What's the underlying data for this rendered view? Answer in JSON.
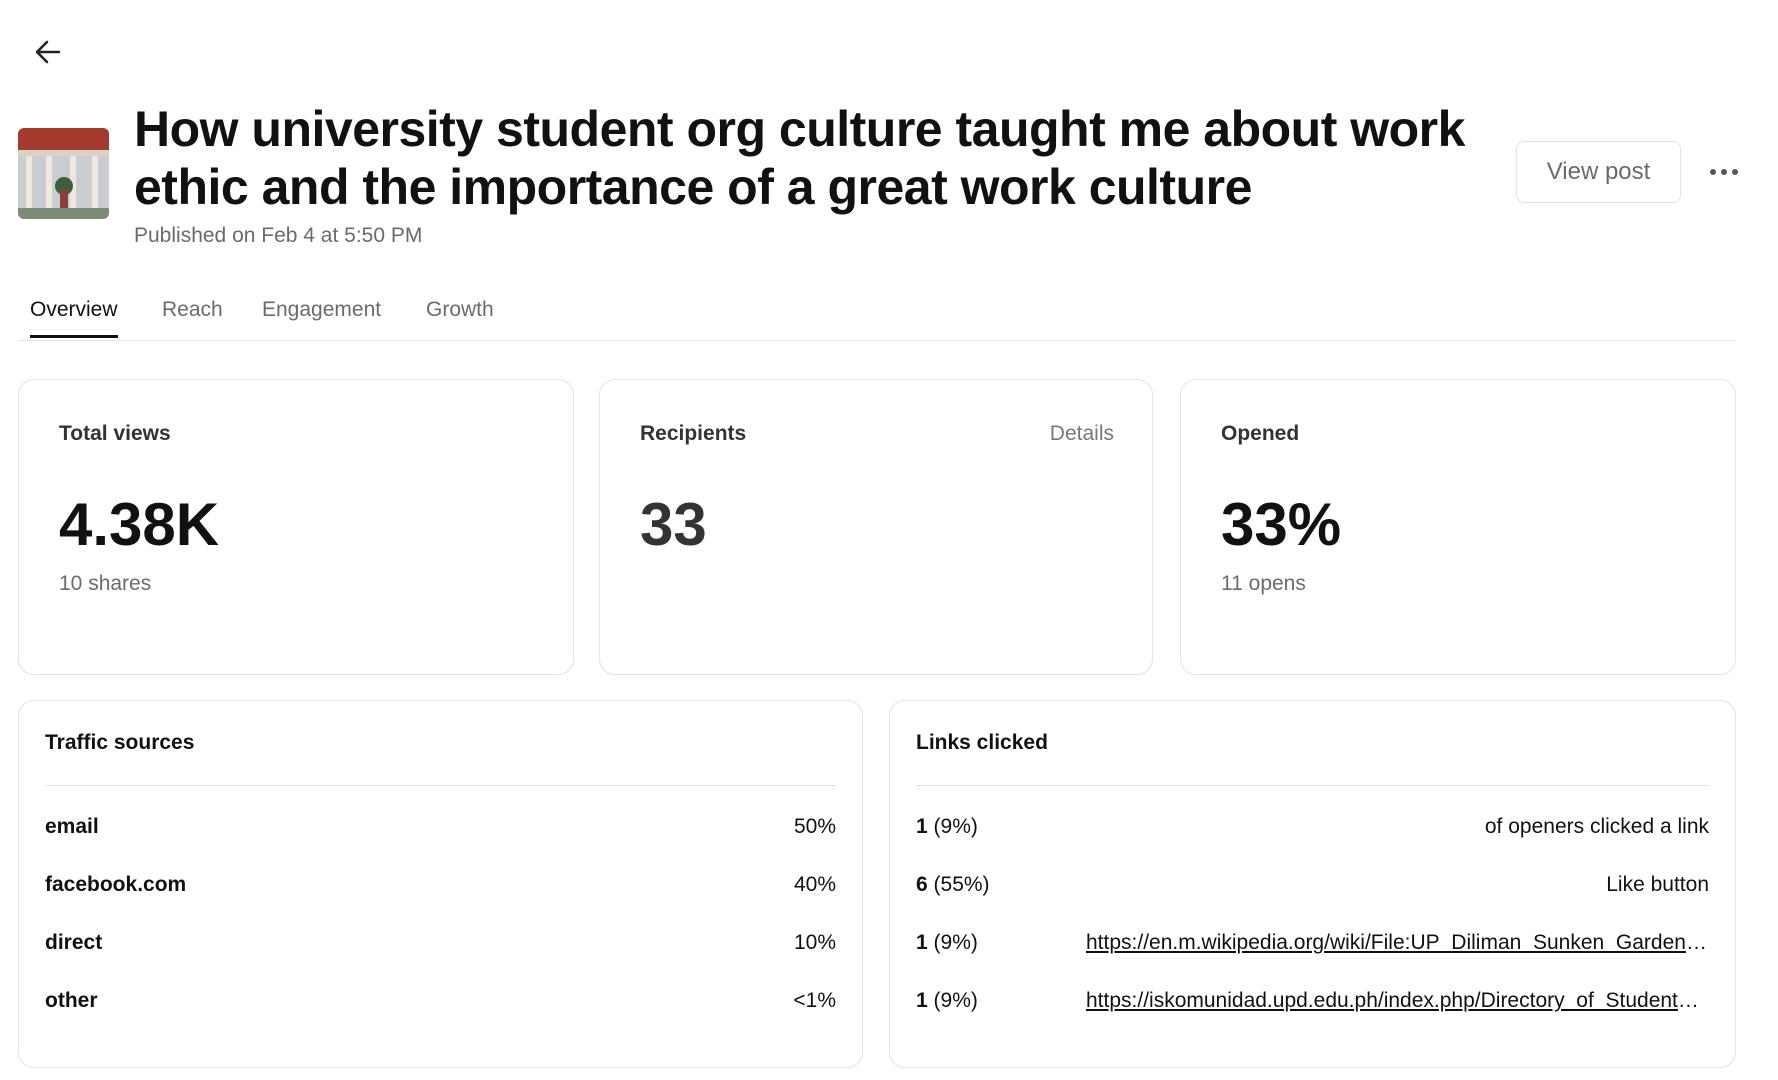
{
  "header": {
    "title": "How university student org culture taught me about work ethic and the importance of a great work culture",
    "published": "Published on Feb 4 at 5:50 PM",
    "view_post_label": "View post",
    "back_icon": "arrow-left-icon",
    "more_icon": "ellipsis-icon"
  },
  "tabs": [
    {
      "label": "Overview",
      "active": true
    },
    {
      "label": "Reach",
      "active": false
    },
    {
      "label": "Engagement",
      "active": false
    },
    {
      "label": "Growth",
      "active": false
    }
  ],
  "stats": {
    "total_views": {
      "label": "Total views",
      "value": "4.38K",
      "sub": "10 shares"
    },
    "recipients": {
      "label": "Recipients",
      "value": "33",
      "link": "Details"
    },
    "opened": {
      "label": "Opened",
      "value": "33%",
      "sub": "11 opens"
    }
  },
  "traffic_sources": {
    "title": "Traffic sources",
    "rows": [
      {
        "source": "email",
        "percent": "50%"
      },
      {
        "source": "facebook.com",
        "percent": "40%"
      },
      {
        "source": "direct",
        "percent": "10%"
      },
      {
        "source": "other",
        "percent": "<1%"
      }
    ]
  },
  "links_clicked": {
    "title": "Links clicked",
    "rows": [
      {
        "count": "1",
        "percent": "(9%)",
        "target": "of openers clicked a link"
      },
      {
        "count": "6",
        "percent": "(55%)",
        "target": "Like button"
      },
      {
        "count": "1",
        "percent": "(9%)",
        "target": "https://en.m.wikipedia.org/wiki/File:UP_Diliman_Sunken_Garden.jpg"
      },
      {
        "count": "1",
        "percent": "(9%)",
        "target": "https://iskomunidad.upd.edu.ph/index.php/Directory_of_Student_Organizations"
      }
    ]
  },
  "colors": {
    "text": "#111111",
    "muted": "#6b6b6b",
    "border": "#e3e3e3"
  }
}
